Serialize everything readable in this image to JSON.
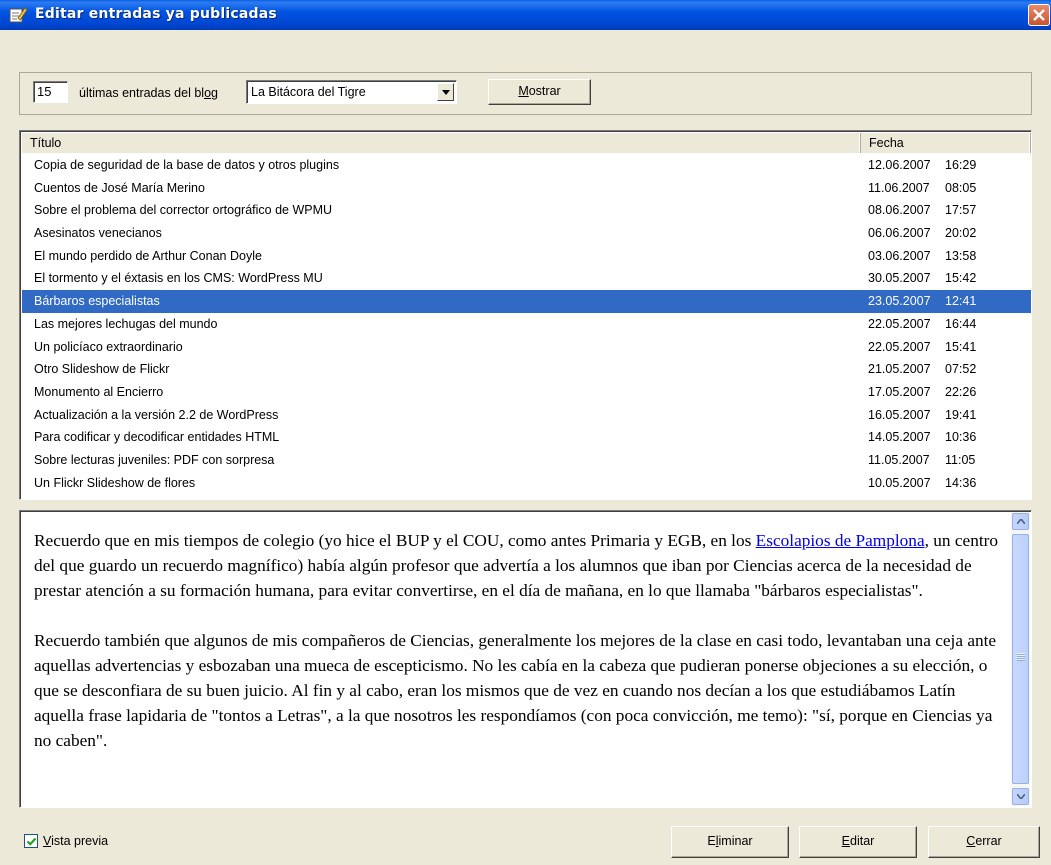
{
  "window": {
    "title": "Editar entradas ya publicadas"
  },
  "filter": {
    "count_value": "15",
    "label_pre": "últimas entradas del bl",
    "label_ul": "o",
    "label_post": "g",
    "blog_selected": "La Bitácora del Tigre",
    "show_button_ul": "M",
    "show_button_rest": "ostrar"
  },
  "list": {
    "columns": {
      "title": "Título",
      "date": "Fecha"
    },
    "rows": [
      {
        "title": "Copia de seguridad de la base de datos y otros plugins",
        "date": "12.06.2007",
        "time": "16:29"
      },
      {
        "title": "Cuentos de José María Merino",
        "date": "11.06.2007",
        "time": "08:05"
      },
      {
        "title": "Sobre el problema del corrector ortográfico de WPMU",
        "date": "08.06.2007",
        "time": "17:57"
      },
      {
        "title": "Asesinatos venecianos",
        "date": "06.06.2007",
        "time": "20:02"
      },
      {
        "title": "El mundo perdido de Arthur Conan Doyle",
        "date": "03.06.2007",
        "time": "13:58"
      },
      {
        "title": "El tormento y el éxtasis en los CMS: WordPress MU",
        "date": "30.05.2007",
        "time": "15:42"
      },
      {
        "title": "Bárbaros especialistas",
        "date": "23.05.2007",
        "time": "12:41",
        "selected": true
      },
      {
        "title": "Las mejores lechugas del mundo",
        "date": "22.05.2007",
        "time": "16:44"
      },
      {
        "title": "Un policíaco extraordinario",
        "date": "22.05.2007",
        "time": "15:41"
      },
      {
        "title": "Otro Slideshow de Flickr",
        "date": "21.05.2007",
        "time": "07:52"
      },
      {
        "title": "Monumento al Encierro",
        "date": "17.05.2007",
        "time": "22:26"
      },
      {
        "title": "Actualización a la versión 2.2 de WordPress",
        "date": "16.05.2007",
        "time": "19:41"
      },
      {
        "title": "Para codificar y decodificar entidades HTML",
        "date": "14.05.2007",
        "time": "10:36"
      },
      {
        "title": "Sobre lecturas juveniles: PDF con sorpresa",
        "date": "11.05.2007",
        "time": "11:05"
      },
      {
        "title": "Un Flickr Slideshow de flores",
        "date": "10.05.2007",
        "time": "14:36"
      }
    ]
  },
  "preview": {
    "p1_before": "Recuerdo que en mis tiempos de colegio (yo hice el BUP y el COU, como antes Primaria y EGB, en los ",
    "p1_link": "Escolapios de Pamplona",
    "p1_after": ", un centro del que guardo un recuerdo magnífico) había algún profesor que advertía a los alumnos que iban por Ciencias acerca de la necesidad de prestar atención a su formación humana, para evitar convertirse, en el día de mañana, en lo que llamaba \"bárbaros especialistas\".",
    "p2": "Recuerdo también que algunos de mis compañeros de Ciencias, generalmente los mejores de la clase en casi todo, levantaban una ceja ante aquellas advertencias y esbozaban una mueca de escepticismo. No les cabía en la cabeza que pudieran ponerse objeciones a su elección, o que se desconfiara de su buen juicio. Al fin y al cabo, eran los mismos que de vez en cuando nos decían a los que estudiábamos Latín aquella frase lapidaria de \"tontos a Letras\", a la que nosotros les respondíamos (con poca convicción, me temo): \"sí, porque en Ciencias ya no caben\"."
  },
  "footer": {
    "preview_check_ul": "V",
    "preview_check_rest": "ista previa",
    "preview_checked": true,
    "delete_pre": "E",
    "delete_ul": "l",
    "delete_post": "iminar",
    "edit_ul": "E",
    "edit_rest": "ditar",
    "close_ul": "C",
    "close_rest": "errar"
  },
  "colors": {
    "selection": "#316ac5",
    "titlebar": "#0053e1",
    "face": "#ece9d8",
    "link": "#0000ee"
  },
  "icons": [
    "edit-document-icon",
    "close-icon",
    "dropdown-arrow-icon",
    "scroll-up-icon",
    "scroll-down-icon",
    "checkmark-icon"
  ]
}
